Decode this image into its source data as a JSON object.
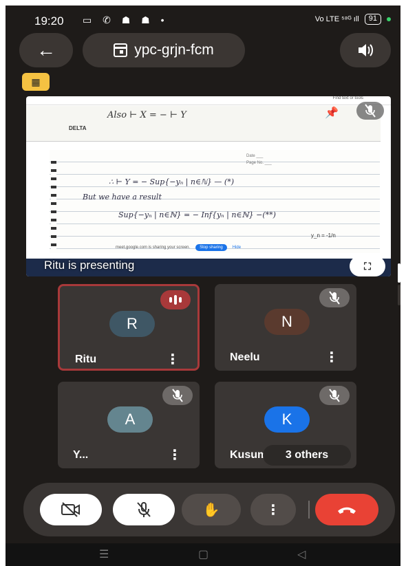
{
  "status": {
    "time": "19:20",
    "icons": "▭ ✆ ☗ ☗ •",
    "network": "Vo LTE ⁵⁸ᴳ ıll",
    "battery": "91"
  },
  "header": {
    "back_icon": "arrow-left",
    "meeting_code": "ypc-grjn-fcm",
    "speaker_icon": "speaker"
  },
  "presentation": {
    "label": "Ritu is presenting",
    "pdf_toolbar": "Find text or tools",
    "page1_text": "Also   ⊢ X = − ⊢ Y",
    "notebook_brand": "DELTA",
    "datebox": "Date ___\nPage No. ___",
    "lines": [
      "∴   ⊢ Y = − Sup{−yₙ | n∈ℕ}  — (*)",
      "But  we  have  a  result",
      "Sup{−yₙ | n∈ℕ}  =  − Inf{yₙ | n∈ℕ}  −(**)"
    ],
    "formula_note": "y_n = -1/n",
    "share_text": "meet.google.com is sharing your screen.",
    "stop_sharing": "Stop sharing",
    "hide": "Hide",
    "fullscreen_icon": "fullscreen",
    "pin_icon": "pin",
    "mic_icon": "mic-off"
  },
  "participants": [
    {
      "initial": "R",
      "name": "Ritu",
      "color": "#3f5765",
      "state": "speaking"
    },
    {
      "initial": "N",
      "name": "Neelu",
      "color": "#5a3a2e",
      "state": "muted"
    },
    {
      "initial": "A",
      "name": "Y...",
      "color": "#64858f",
      "state": "muted"
    },
    {
      "initial": "K",
      "name": "Kusum",
      "color": "#1a73e8",
      "state": "muted",
      "others_label": "3 others"
    }
  ],
  "controls": {
    "camera_icon": "camera-off",
    "mic_icon": "mic-off",
    "hand_icon": "raise-hand",
    "more_icon": "more-vertical",
    "end_icon": "end-call",
    "end_color": "#e94235"
  },
  "navbar": {
    "menu_icon": "menu",
    "home_icon": "home",
    "back_icon": "back"
  }
}
